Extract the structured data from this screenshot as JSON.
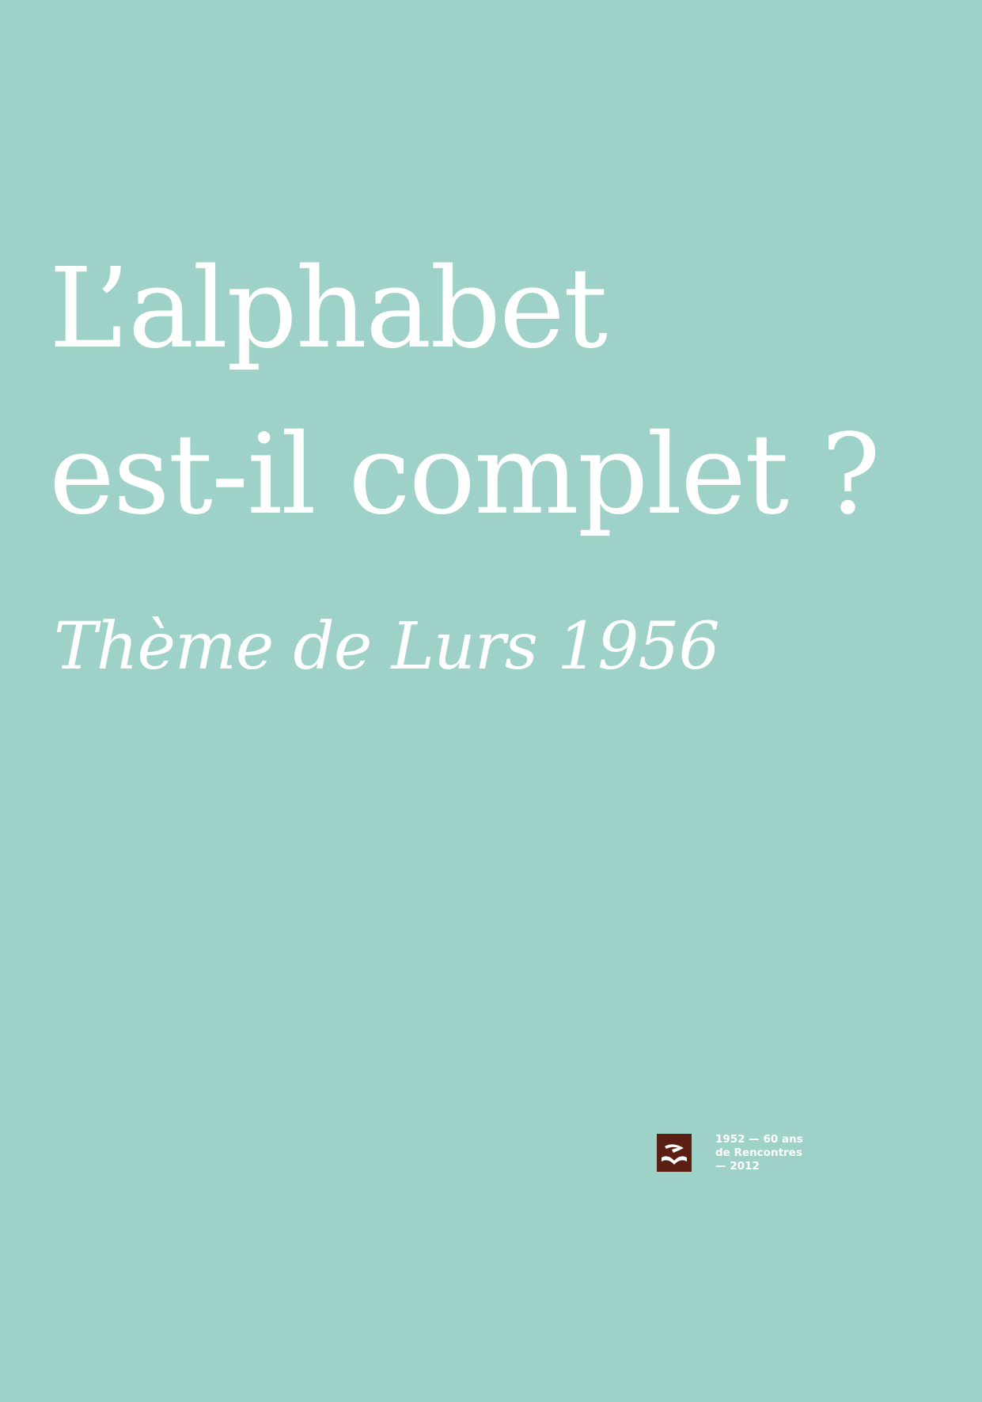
{
  "page": {
    "background_color": "#9ed1c7",
    "text_color": "#ffffff"
  },
  "title": {
    "line1": "L’alphabet",
    "line2": "est-il complet ?"
  },
  "subtitle": "Thème de Lurs 1956",
  "footer": {
    "logo_icon": "rencontres-de-lurs-logo-icon",
    "logo_color": "#5a1f12",
    "line1": "1952 — 60 ans",
    "line2": "de Rencontres",
    "line3": "— 2012"
  }
}
